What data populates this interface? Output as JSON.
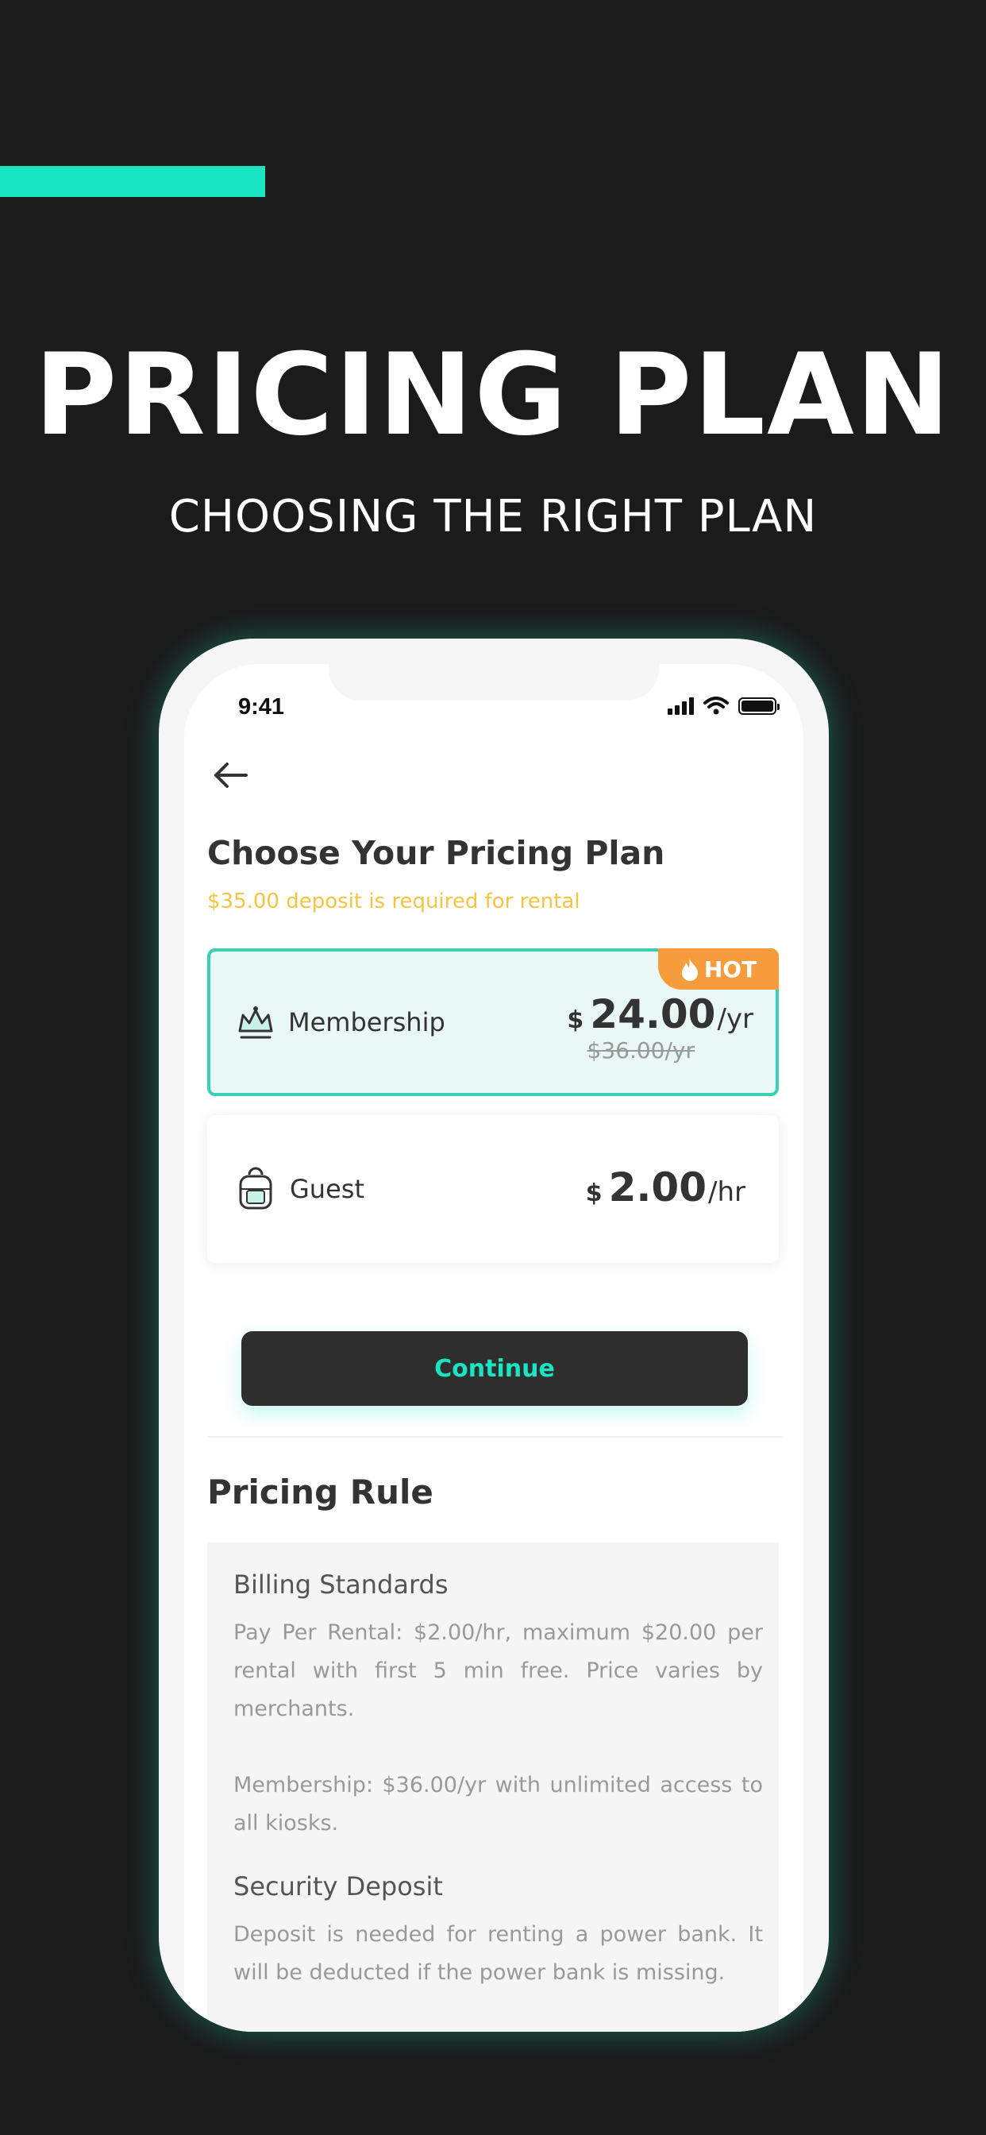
{
  "hero": {
    "title": "PRICING PLAN",
    "subtitle": "CHOOSING THE RIGHT PLAN"
  },
  "status_bar": {
    "time": "9:41",
    "icons": [
      "signal-icon",
      "wifi-icon",
      "battery-icon"
    ]
  },
  "header": {
    "back_icon": "back-arrow-icon",
    "title": "Choose Your Pricing Plan",
    "deposit_note": "$35.00 deposit is required for rental"
  },
  "plans": [
    {
      "icon": "crown-icon",
      "name": "Membership",
      "currency": "$",
      "amount": "24.00",
      "unit": "/yr",
      "old_price": "$36.00/yr",
      "badge": "HOT",
      "badge_icon": "flame-icon",
      "selected": true
    },
    {
      "icon": "backpack-icon",
      "name": "Guest",
      "currency": "$",
      "amount": "2.00",
      "unit": "/hr",
      "selected": false
    }
  ],
  "continue_label": "Continue",
  "pricing_rule": {
    "title": "Pricing Rule",
    "billing_heading": "Billing Standards",
    "billing_text_1": "Pay Per Rental: $2.00/hr, maximum $20.00 per rental with first 5 min free. Price varies by merchants.",
    "billing_text_2": "Membership: $36.00/yr with unlimited access to all kiosks.",
    "deposit_heading": "Security Deposit",
    "deposit_text": "Deposit is needed for renting a power bank. It will be deducted if the power bank is missing."
  },
  "colors": {
    "background": "#1b1b1b",
    "accent": "#19e5c3",
    "deposit_note": "#f7c440",
    "hot_badge": "#f79c3c",
    "selected_card_border": "#39d1b4",
    "selected_card_bg": "#e9f8f4",
    "button_bg": "#2e2e2e"
  }
}
